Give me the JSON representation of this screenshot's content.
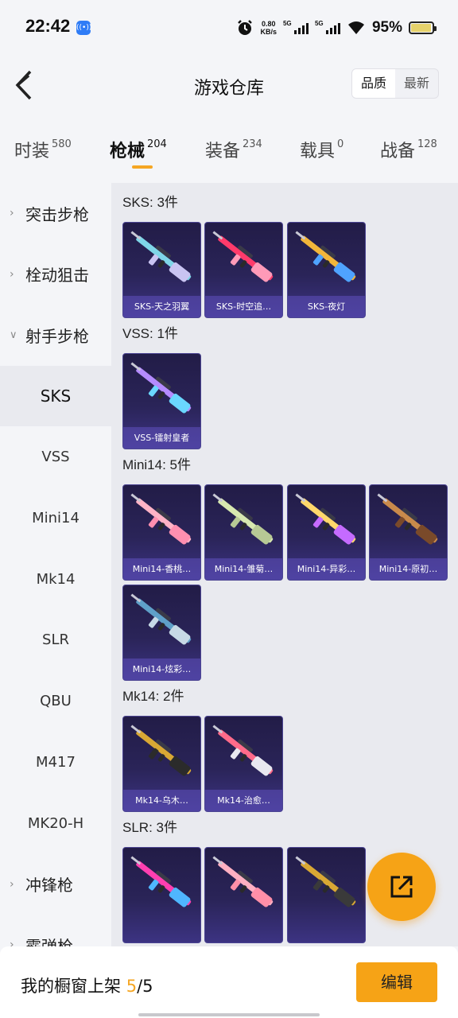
{
  "status_bar": {
    "time": "22:42",
    "nfc_icon": "nfc-icon",
    "speed_value": "0.80",
    "speed_unit": "KB/s",
    "sig1_tag": "5G",
    "sig2_tag": "5G",
    "battery_pct": "95%",
    "battery_level": 0.95
  },
  "header": {
    "title": "游戏仓库",
    "sort_options": [
      "品质",
      "最新"
    ],
    "sort_selected": "品质"
  },
  "tabs": [
    {
      "label": "时装",
      "count": "580"
    },
    {
      "label": "枪械",
      "count": "204",
      "active": true
    },
    {
      "label": "装备",
      "count": "234"
    },
    {
      "label": "载具",
      "count": "0"
    },
    {
      "label": "战备",
      "count": "128"
    }
  ],
  "sidebar": [
    {
      "label": "突击步枪",
      "type": "group",
      "expanded": false
    },
    {
      "label": "栓动狙击",
      "type": "group",
      "expanded": false
    },
    {
      "label": "射手步枪",
      "type": "group",
      "expanded": true
    },
    {
      "label": "SKS",
      "type": "sub",
      "active": true
    },
    {
      "label": "VSS",
      "type": "sub"
    },
    {
      "label": "Mini14",
      "type": "sub"
    },
    {
      "label": "Mk14",
      "type": "sub"
    },
    {
      "label": "SLR",
      "type": "sub"
    },
    {
      "label": "QBU",
      "type": "sub"
    },
    {
      "label": "M417",
      "type": "sub"
    },
    {
      "label": "MK20-H",
      "type": "sub"
    },
    {
      "label": "冲锋枪",
      "type": "group",
      "expanded": false
    },
    {
      "label": "霰弹枪",
      "type": "group",
      "expanded": false
    }
  ],
  "sections": [
    {
      "title": "SKS: 3件",
      "items": [
        {
          "name": "SKS-天之羽翼",
          "colors": [
            "#7fd6e8",
            "#c9c4f2"
          ]
        },
        {
          "name": "SKS-时空追…",
          "colors": [
            "#ff3b6b",
            "#ff9ab8"
          ]
        },
        {
          "name": "SKS-夜灯",
          "colors": [
            "#f2b63a",
            "#4fa3ff"
          ]
        }
      ]
    },
    {
      "title": "VSS: 1件",
      "items": [
        {
          "name": "VSS-镭射皇者",
          "colors": [
            "#b58bff",
            "#6ad7ff"
          ]
        }
      ]
    },
    {
      "title": "Mini14: 5件",
      "items": [
        {
          "name": "Mini14-香桃…",
          "colors": [
            "#ffb3c6",
            "#ff8fb0"
          ]
        },
        {
          "name": "Mini14-雏菊…",
          "colors": [
            "#d7e8b0",
            "#b7c995"
          ]
        },
        {
          "name": "Mini14-异彩…",
          "colors": [
            "#ffd86b",
            "#c56bff"
          ]
        },
        {
          "name": "Mini14-原初…",
          "colors": [
            "#c98a4b",
            "#7a4a2a"
          ]
        },
        {
          "name": "Mini14-炫彩…",
          "colors": [
            "#5fa0c9",
            "#c7d9e6"
          ]
        }
      ]
    },
    {
      "title": "Mk14: 2件",
      "items": [
        {
          "name": "Mk14-乌木…",
          "colors": [
            "#d9a834",
            "#2b2b2b"
          ]
        },
        {
          "name": "Mk14-治愈…",
          "colors": [
            "#ff6b8a",
            "#e8e8f0"
          ]
        }
      ]
    },
    {
      "title": "SLR: 3件",
      "items": [
        {
          "name": "",
          "colors": [
            "#ff3fb0",
            "#4fb6ff"
          ]
        },
        {
          "name": "",
          "colors": [
            "#ffb0c2",
            "#ff8fa8"
          ]
        },
        {
          "name": "",
          "colors": [
            "#d9a834",
            "#3a3a3a"
          ]
        }
      ]
    }
  ],
  "fab": {
    "icon": "share-out-icon"
  },
  "bottom_bar": {
    "label": "我的橱窗上架",
    "current": "5",
    "total": "/5",
    "edit_label": "编辑"
  },
  "colors": {
    "accent": "#f6a316",
    "card_dark": "#221c47",
    "card_light": "#3c3382"
  }
}
